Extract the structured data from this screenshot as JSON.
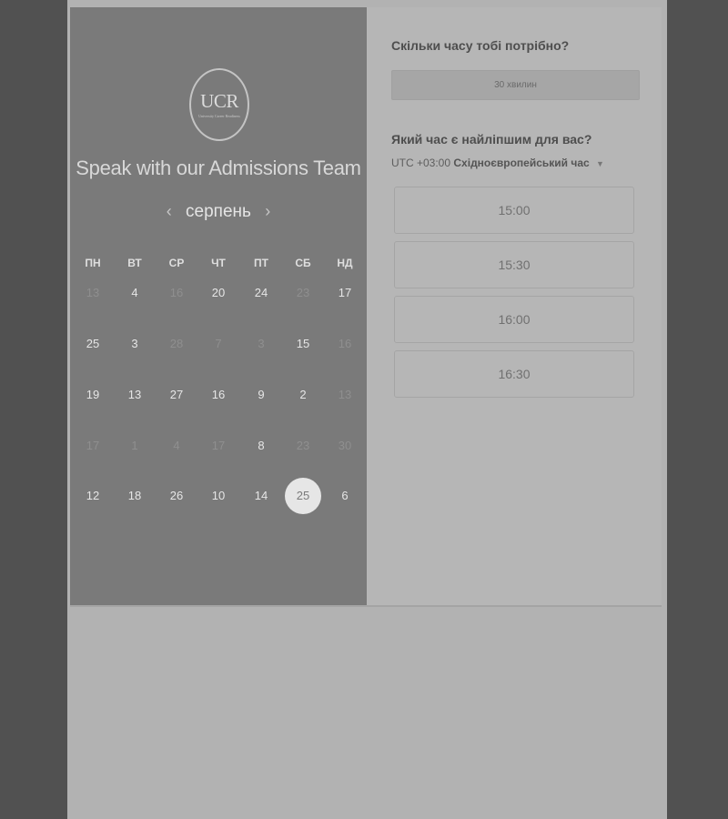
{
  "brand": {
    "logo_text": "UCR",
    "logo_subtext": "University Career Readiness"
  },
  "left_panel": {
    "title": "Speak with our Admissions Team",
    "month": "серпень",
    "prev_icon": "chevron-left-icon",
    "next_icon": "chevron-right-icon",
    "weekdays": [
      "ПН",
      "ВТ",
      "СР",
      "ЧТ",
      "ПТ",
      "СБ",
      "НД"
    ],
    "days": [
      [
        {
          "label": "13",
          "disabled": true
        },
        {
          "label": "4",
          "disabled": false
        },
        {
          "label": "16",
          "disabled": true
        },
        {
          "label": "20",
          "disabled": false
        },
        {
          "label": "24",
          "disabled": false
        },
        {
          "label": "23",
          "disabled": true
        },
        {
          "label": "17",
          "disabled": false
        }
      ],
      [
        {
          "label": "25",
          "disabled": false
        },
        {
          "label": "3",
          "disabled": false
        },
        {
          "label": "28",
          "disabled": true
        },
        {
          "label": "7",
          "disabled": true
        },
        {
          "label": "3",
          "disabled": true
        },
        {
          "label": "15",
          "disabled": false
        },
        {
          "label": "16",
          "disabled": true
        }
      ],
      [
        {
          "label": "19",
          "disabled": false
        },
        {
          "label": "13",
          "disabled": false
        },
        {
          "label": "27",
          "disabled": false
        },
        {
          "label": "16",
          "disabled": false
        },
        {
          "label": "9",
          "disabled": false
        },
        {
          "label": "2",
          "disabled": false
        },
        {
          "label": "13",
          "disabled": true
        }
      ],
      [
        {
          "label": "17",
          "disabled": true
        },
        {
          "label": "1",
          "disabled": true
        },
        {
          "label": "4",
          "disabled": true
        },
        {
          "label": "17",
          "disabled": true
        },
        {
          "label": "8",
          "disabled": false
        },
        {
          "label": "23",
          "disabled": true
        },
        {
          "label": "30",
          "disabled": true
        }
      ],
      [
        {
          "label": "12",
          "disabled": false
        },
        {
          "label": "18",
          "disabled": false
        },
        {
          "label": "26",
          "disabled": false
        },
        {
          "label": "10",
          "disabled": false
        },
        {
          "label": "14",
          "disabled": false
        },
        {
          "label": "25",
          "disabled": false,
          "selected": true
        },
        {
          "label": "6",
          "disabled": false
        }
      ]
    ]
  },
  "right_panel": {
    "duration_question": "Скільки часу тобі потрібно?",
    "duration_value": "30 хвилин",
    "time_question": "Який час є найліпшим для вас?",
    "tz_offset": "UTC +03:00",
    "tz_name": "Східноєвропейський час",
    "tz_caret_icon": "caret-down-icon",
    "slots": [
      "15:00",
      "15:30",
      "16:00",
      "16:30"
    ]
  }
}
